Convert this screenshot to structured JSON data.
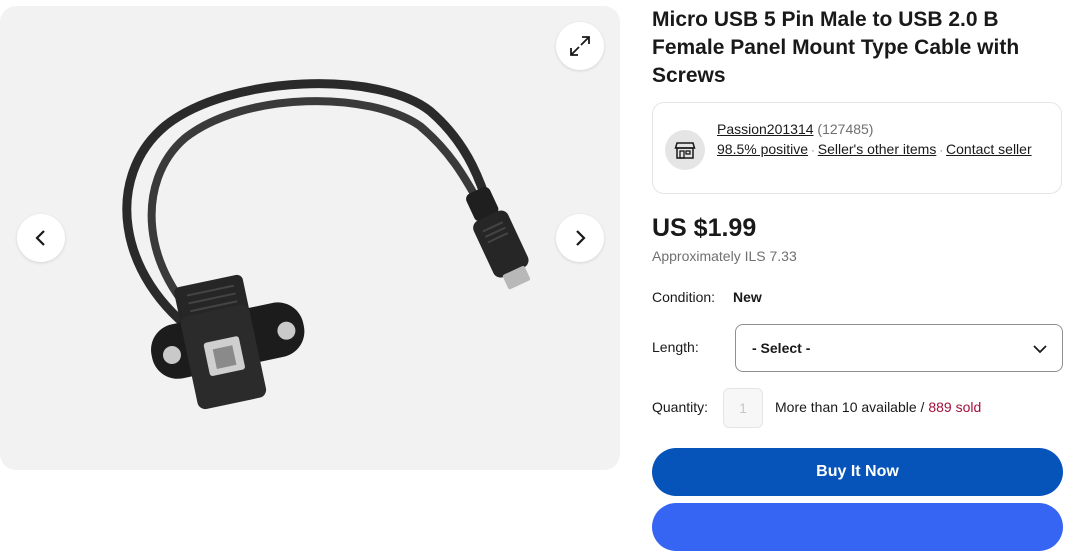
{
  "title": "Micro USB 5 Pin Male to USB 2.0 B Female Panel Mount Type Cable with Screws",
  "seller": {
    "name": "Passion201314",
    "count": "(127485)",
    "positive": "98.5% positive",
    "other_items": "Seller's other items",
    "contact": "Contact seller"
  },
  "price": "US $1.99",
  "approx": "Approximately ILS 7.33",
  "condition": {
    "label": "Condition:",
    "value": "New"
  },
  "length": {
    "label": "Length:",
    "selected": "- Select -"
  },
  "quantity": {
    "label": "Quantity:",
    "value": "1",
    "available": "More than 10 available",
    "separator": "/",
    "sold": "889 sold"
  },
  "buy_now": "Buy It Now",
  "colors": {
    "primary": "#0654ba",
    "sold": "#a2103d",
    "secondary_button": "#3665f3"
  },
  "icons": [
    "expand-icon",
    "chevron-left-icon",
    "chevron-right-icon",
    "store-icon",
    "chevron-down-icon"
  ]
}
